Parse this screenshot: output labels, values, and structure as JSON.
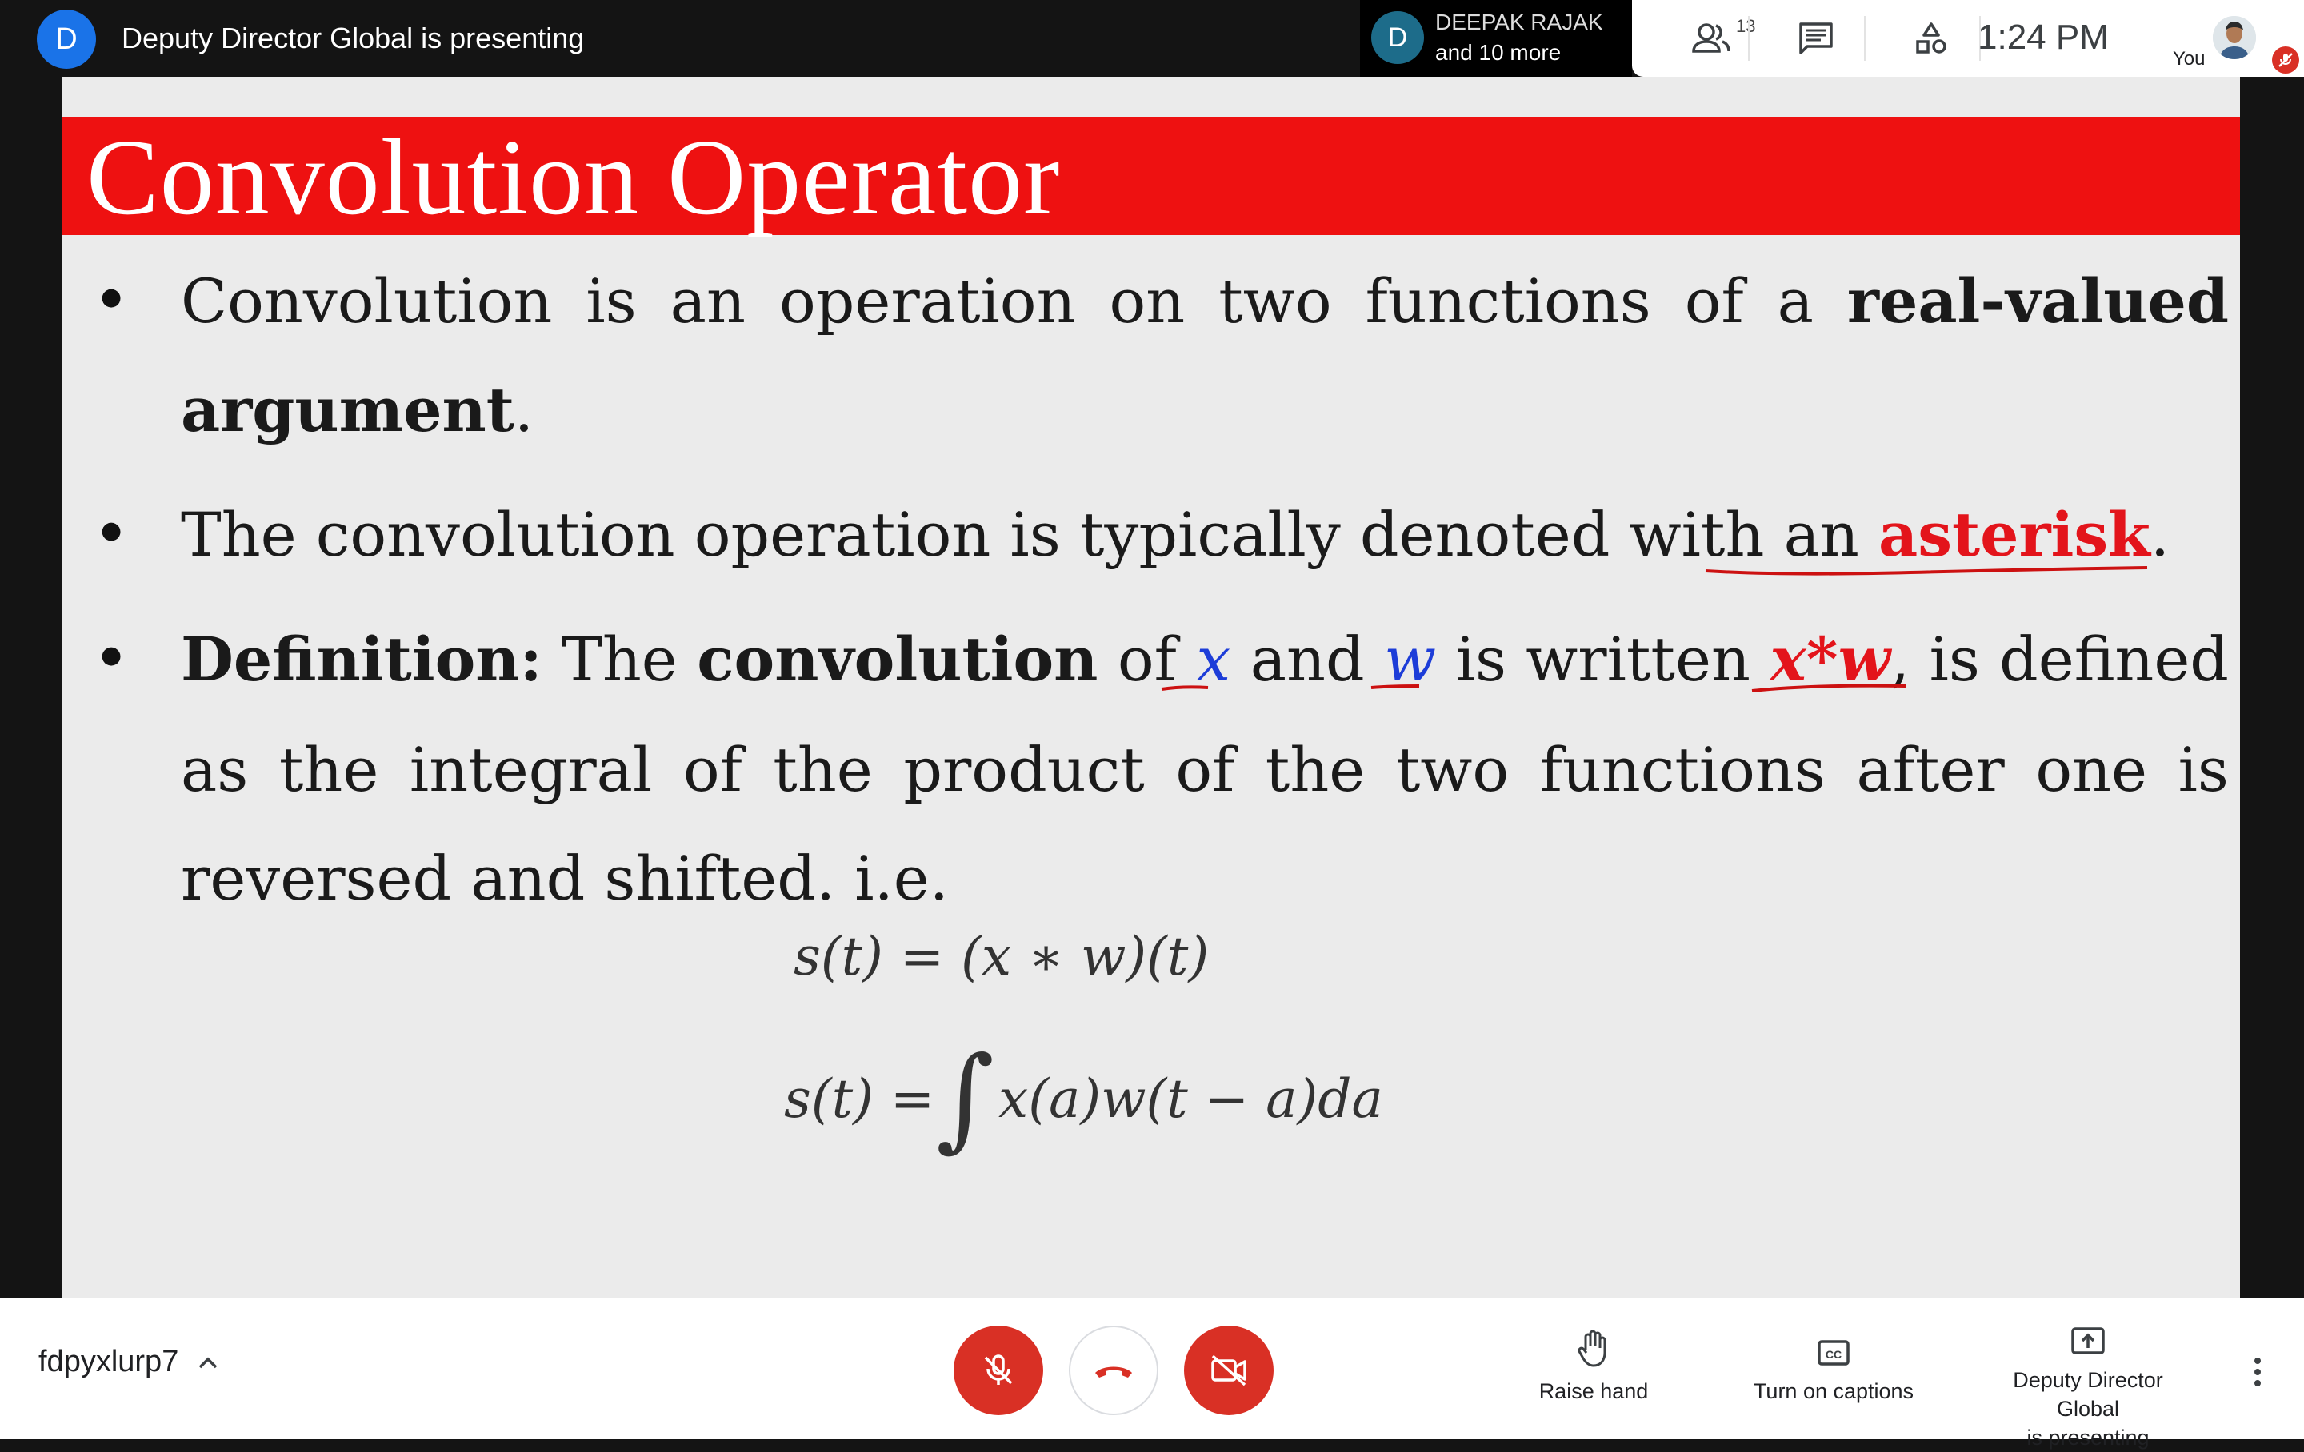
{
  "top_bar": {
    "presenter_initial": "D",
    "presenting_text": "Deputy Director Global is presenting",
    "participant_chip": {
      "initial": "D",
      "name": "DEEPAK RAJAK",
      "more": "and 10 more"
    },
    "people_count": "13",
    "time": "1:24 PM",
    "you_label": "You"
  },
  "slide": {
    "title": "Convolution Operator",
    "bullet1": {
      "words": [
        "Convolution",
        "is",
        "an",
        "operation",
        "on",
        "two",
        "functions",
        "of",
        "a"
      ],
      "bold": "real-valued",
      "line2_bold": "argument",
      "line2_end": "."
    },
    "bullet2": {
      "text": "The convolution operation is typically denoted with an",
      "highlight": "asterisk",
      "end": "."
    },
    "bullet3": {
      "definition": "Definition:",
      "the": "The",
      "convolution": "convolution",
      "of": "of",
      "x": "x",
      "and": "and",
      "w": "w",
      "is_written": "is written",
      "xw": "x*w",
      "comma": ",",
      "is_defined": "is defined",
      "line2_words": [
        "as",
        "the",
        "integral",
        "of",
        "the",
        "product",
        "of",
        "the",
        "two",
        "functions",
        "after",
        "one",
        "is"
      ],
      "line3": "reversed and shifted. i.e."
    },
    "equation1": "s(t) = (x ∗ w)(t)",
    "equation2_lhs": "s(t) =",
    "equation2_integral": "∫",
    "equation2_rhs": "x(a)w(t − a)da"
  },
  "bottom_bar": {
    "meeting_code": "fdpyxlurp7",
    "raise_hand": "Raise hand",
    "captions": "Turn on captions",
    "presenting_line1": "Deputy Director Global",
    "presenting_line2": "is presenting"
  },
  "colors": {
    "title_bar": "#ee1111",
    "accent_red": "#d93025",
    "accent_blue": "#1a73e8"
  }
}
